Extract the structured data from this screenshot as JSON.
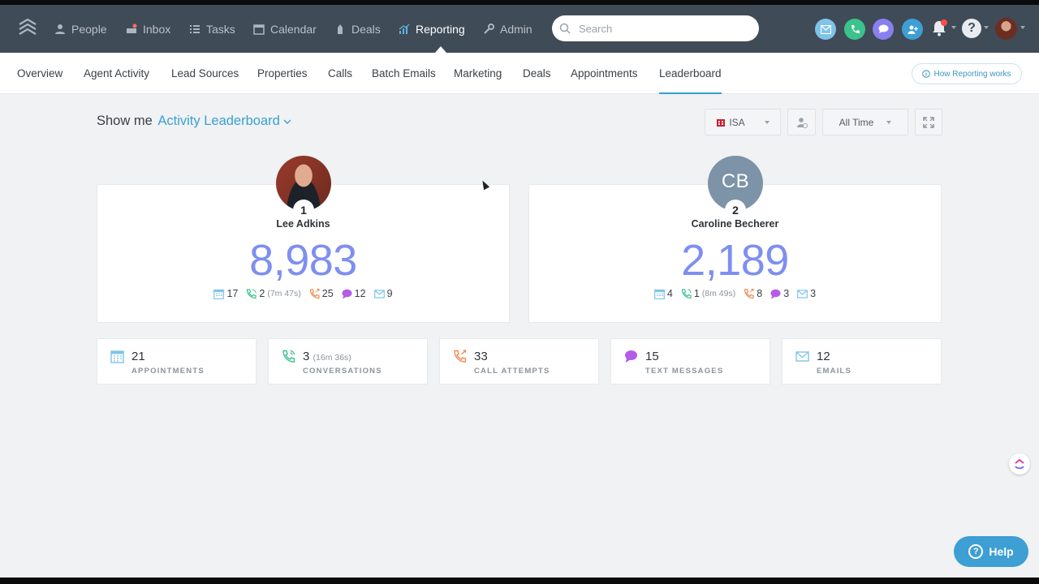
{
  "nav": {
    "items": [
      {
        "label": "People",
        "icon": "person-icon"
      },
      {
        "label": "Inbox",
        "icon": "inbox-icon"
      },
      {
        "label": "Tasks",
        "icon": "tasks-icon"
      },
      {
        "label": "Calendar",
        "icon": "calendar-icon"
      },
      {
        "label": "Deals",
        "icon": "deals-icon"
      },
      {
        "label": "Reporting",
        "icon": "chart-icon",
        "active": true
      },
      {
        "label": "Admin",
        "icon": "wrench-icon"
      }
    ],
    "search_placeholder": "Search",
    "quick_actions": [
      "email-icon",
      "phone-icon",
      "chat-icon",
      "add-person-icon"
    ]
  },
  "subnav": {
    "tabs": [
      "Overview",
      "Agent Activity",
      "Lead Sources",
      "Properties",
      "Calls",
      "Batch Emails",
      "Marketing",
      "Deals",
      "Appointments",
      "Leaderboard"
    ],
    "active_tab": "Leaderboard",
    "how_label": "How Reporting works"
  },
  "controls": {
    "show_me_label": "Show me",
    "report_selected": "Activity Leaderboard",
    "team_filter": "ISA",
    "time_filter": "All Time"
  },
  "leaders": [
    {
      "rank": "1",
      "name": "Lee Adkins",
      "score": "8,983",
      "appointments": "17",
      "conversations": "2",
      "conversations_duration": "(7m 47s)",
      "call_attempts": "25",
      "texts": "12",
      "emails": "9"
    },
    {
      "rank": "2",
      "initials": "CB",
      "name": "Caroline Becherer",
      "score": "2,189",
      "appointments": "4",
      "conversations": "1",
      "conversations_duration": "(8m 49s)",
      "call_attempts": "8",
      "texts": "3",
      "emails": "3"
    }
  ],
  "totals": [
    {
      "value": "21",
      "sub": "",
      "label": "APPOINTMENTS",
      "icon": "calendar-icon"
    },
    {
      "value": "3",
      "sub": "(16m 36s)",
      "label": "CONVERSATIONS",
      "icon": "phone-talk-icon"
    },
    {
      "value": "33",
      "sub": "",
      "label": "CALL ATTEMPTS",
      "icon": "phone-attempt-icon"
    },
    {
      "value": "15",
      "sub": "",
      "label": "TEXT MESSAGES",
      "icon": "chat-icon"
    },
    {
      "value": "12",
      "sub": "",
      "label": "EMAILS",
      "icon": "email-icon"
    }
  ],
  "help_label": "Help",
  "colors": {
    "nav_bg": "#3f4b57",
    "accent": "#3aa0cf",
    "score": "#7e8ff0",
    "calendar": "#7fc4e8",
    "phone": "#3cc28d",
    "call_attempt": "#f08b56",
    "text": "#b45be8",
    "email": "#7fc4e8"
  }
}
